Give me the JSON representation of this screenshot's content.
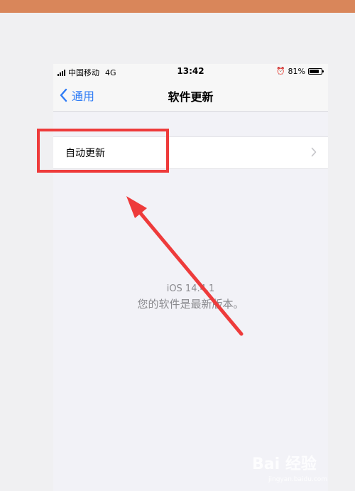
{
  "status_bar": {
    "carrier": "中国移动",
    "network": "4G",
    "time": "13:42",
    "battery_percent": "81%",
    "battery_level": 0.81
  },
  "nav": {
    "back_label": "通用",
    "title": "软件更新"
  },
  "settings": {
    "auto_update_label": "自动更新"
  },
  "update_status": {
    "version": "iOS 14.4.1",
    "message": "您的软件是最新版本。"
  },
  "watermark": {
    "brand": "Bai 经验",
    "url": "jingyan.baidu.com"
  },
  "colors": {
    "accent": "#2f7cf6",
    "annotation": "#ee3b3b",
    "top_band": "#d9865a"
  }
}
